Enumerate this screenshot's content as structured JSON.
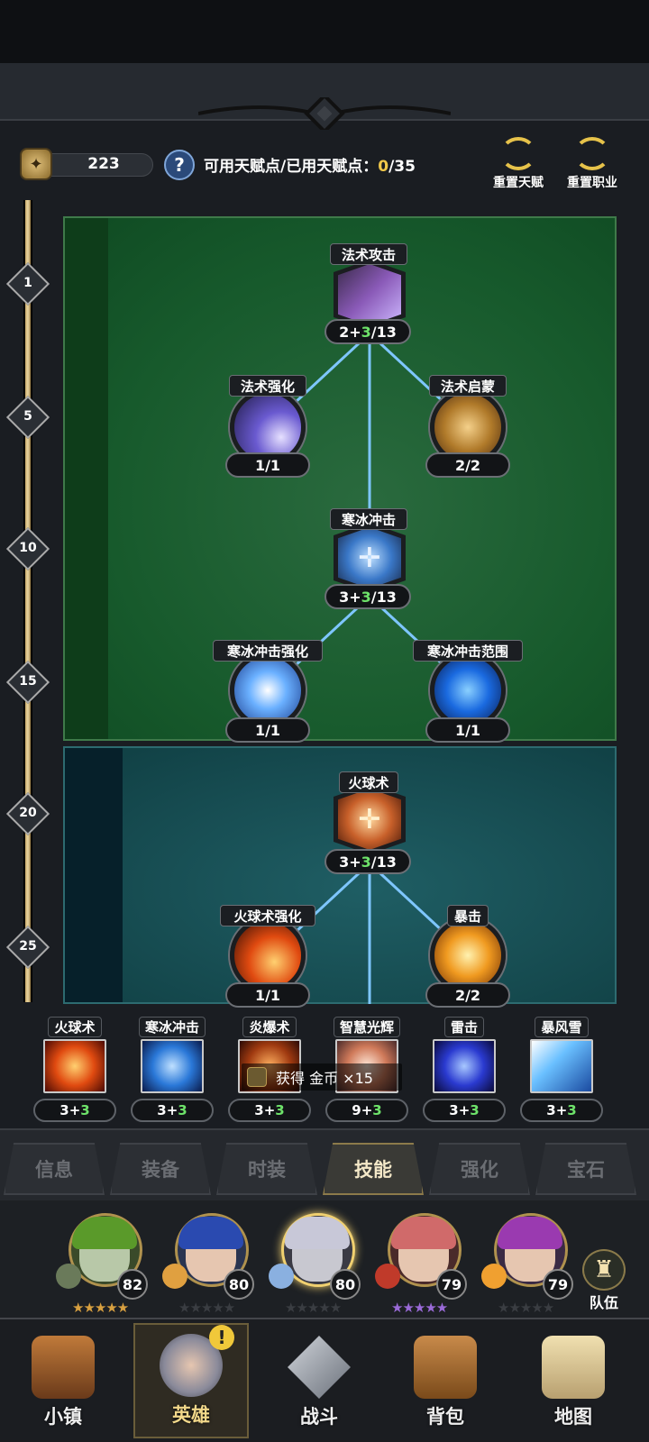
{
  "resources": {
    "coins": "223"
  },
  "talent": {
    "label": "可用天赋点/已用天赋点：",
    "used": "0",
    "total": "/35"
  },
  "actions": {
    "reset_talent": "重置天赋",
    "reset_class": "重置职业"
  },
  "levels": [
    "1",
    "5",
    "10",
    "15",
    "20",
    "25"
  ],
  "tree1": {
    "nodes": [
      {
        "name": "法术攻击",
        "base": "2+",
        "bonus": "3",
        "max": "/13"
      },
      {
        "name": "法术强化",
        "value": "1/1"
      },
      {
        "name": "法术启蒙",
        "value": "2/2"
      },
      {
        "name": "寒冰冲击",
        "base": "3+",
        "bonus": "3",
        "max": "/13"
      },
      {
        "name": "寒冰冲击强化",
        "value": "1/1"
      },
      {
        "name": "寒冰冲击范围",
        "value": "1/1"
      }
    ]
  },
  "tree2": {
    "nodes": [
      {
        "name": "火球术",
        "base": "3+",
        "bonus": "3",
        "max": "/13"
      },
      {
        "name": "火球术强化",
        "value": "1/1"
      },
      {
        "name": "暴击",
        "value": "2/2"
      }
    ]
  },
  "skills": [
    {
      "name": "火球术",
      "base": "3+",
      "bonus": "3"
    },
    {
      "name": "寒冰冲击",
      "base": "3+",
      "bonus": "3"
    },
    {
      "name": "炎爆术",
      "base": "3+",
      "bonus": "3"
    },
    {
      "name": "智慧光辉",
      "base": "9+",
      "bonus": "3"
    },
    {
      "name": "雷击",
      "base": "3+",
      "bonus": "3"
    },
    {
      "name": "暴风雪",
      "base": "3+",
      "bonus": "3"
    }
  ],
  "toast": {
    "text": "获得 金币 ×15"
  },
  "tabs": [
    "信息",
    "装备",
    "时装",
    "技能",
    "强化",
    "宝石"
  ],
  "active_tab": "技能",
  "heroes": [
    {
      "level": "82"
    },
    {
      "level": "80"
    },
    {
      "level": "80"
    },
    {
      "level": "79"
    },
    {
      "level": "79"
    }
  ],
  "team_label": "队伍",
  "nav": [
    "小镇",
    "英雄",
    "战斗",
    "背包",
    "地图"
  ],
  "active_nav": "英雄",
  "alert": "!",
  "colors": {
    "accent_green": "#6ee36a",
    "gold": "#f0c84a",
    "panel_green": "#175a2c",
    "panel_teal": "#164b50"
  }
}
